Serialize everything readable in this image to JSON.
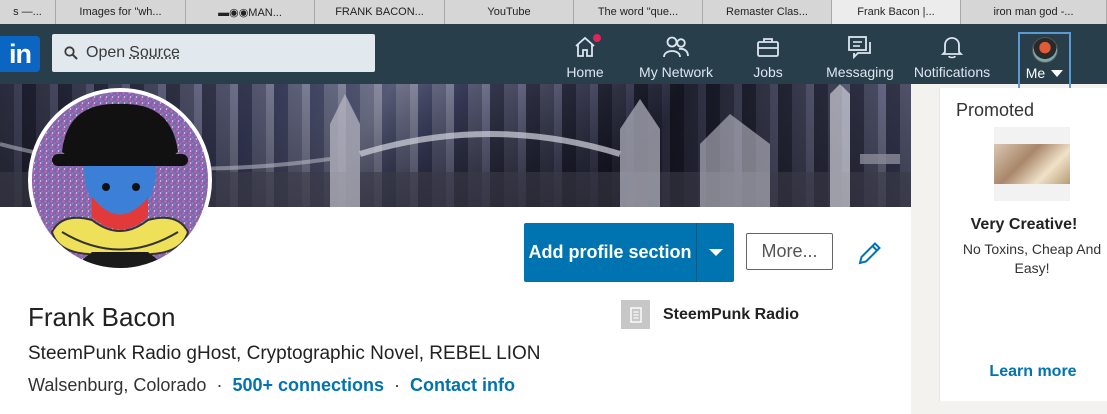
{
  "browser": {
    "tabs": [
      {
        "label": "s —..."
      },
      {
        "label": "Images for \"wh..."
      },
      {
        "label": "▬◉◉MAN..."
      },
      {
        "label": "FRANK BACON..."
      },
      {
        "label": "YouTube"
      },
      {
        "label": "The word \"que..."
      },
      {
        "label": "Remaster Clas..."
      },
      {
        "label": "Frank Bacon |..."
      },
      {
        "label": "iron man god -..."
      }
    ]
  },
  "nav": {
    "logo": "in",
    "search_value_1": "Open",
    "search_value_2": "Source",
    "items": [
      {
        "label": "Home",
        "icon": "home-icon"
      },
      {
        "label": "My Network",
        "icon": "network-icon"
      },
      {
        "label": "Jobs",
        "icon": "briefcase-icon"
      },
      {
        "label": "Messaging",
        "icon": "messaging-icon"
      },
      {
        "label": "Notifications",
        "icon": "bell-icon"
      }
    ],
    "me_label": "Me",
    "accent": "#283e4a"
  },
  "profile": {
    "name": "Frank Bacon",
    "headline": "SteemPunk Radio gHost, Cryptographic Novel, REBEL LION",
    "location": "Walsenburg, Colorado",
    "connections": "500+ connections",
    "contact": "Contact info",
    "separator": "·",
    "organization": "SteemPunk Radio",
    "add_section_label": "Add profile section",
    "more_label": "More...",
    "brand_color": "#0073b1"
  },
  "promoted": {
    "header": "Promoted",
    "title": "Very Creative!",
    "description": "No Toxins, Cheap And Easy!",
    "link": "Learn more"
  }
}
